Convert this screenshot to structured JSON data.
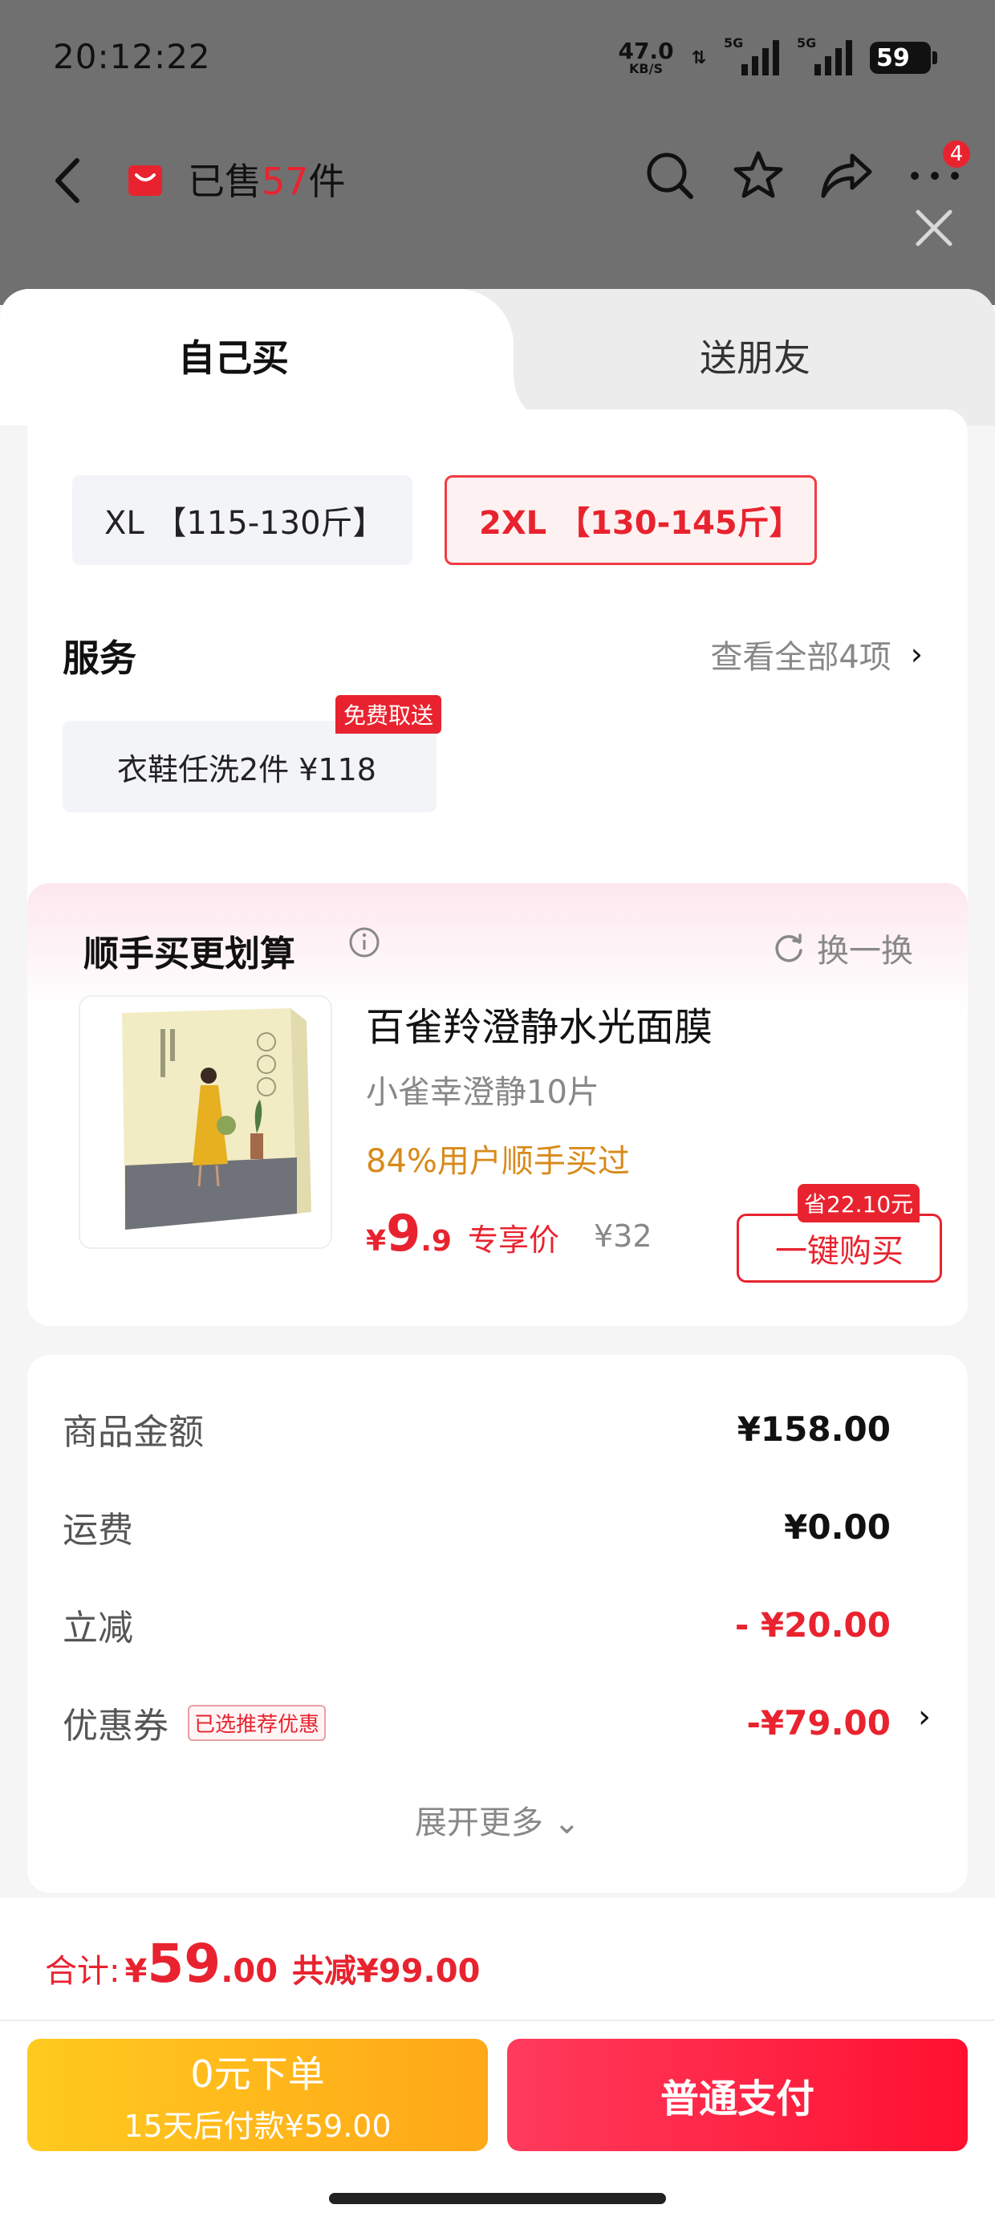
{
  "status_bar": {
    "time": "20:12:22",
    "net_speed": "47.0",
    "net_unit": "KB/S",
    "net_arrows": "⇅",
    "signal1_label": "5G",
    "signal2_label": "5G",
    "battery": "59"
  },
  "nav": {
    "sold_prefix": "已售",
    "sold_count": "57",
    "sold_suffix": "件",
    "more_badge": "4"
  },
  "tabs": {
    "self": "自己买",
    "friend": "送朋友"
  },
  "sizes": {
    "xl": "XL 【115-130斤】",
    "xxl": "2XL 【130-145斤】",
    "selected": "2XL 【130-145斤】"
  },
  "service": {
    "title": "服务",
    "view_all": "查看全部4项",
    "item": "衣鞋任洗2件 ¥118",
    "tag": "免费取送"
  },
  "addon": {
    "title": "顺手买更划算",
    "refresh": "换一换",
    "name": "百雀羚澄静水光面膜",
    "spec": "小雀幸澄静10片",
    "rate": "84%用户顺手买过",
    "price_symbol": "¥",
    "price_int": "9",
    "price_dec": ".9",
    "price_tag": "专享价",
    "orig_price": "¥32",
    "save_tag": "省22.10元",
    "buy": "一键购买"
  },
  "summary": {
    "goods_label": "商品金额",
    "goods_value": "¥158.00",
    "ship_label": "运费",
    "ship_value": "¥0.00",
    "cut_label": "立减",
    "cut_value": "- ¥20.00",
    "coupon_label": "优惠券",
    "coupon_tag": "已选推荐优惠",
    "coupon_value": "-¥79.00",
    "expand": "展开更多"
  },
  "bottom": {
    "total_label": "合计:",
    "total_symbol": "¥",
    "total_int": "59",
    "total_dec": ".00",
    "total_cut": "共减¥99.00",
    "zero_l1": "0元下单",
    "zero_l2": "15天后付款¥59.00",
    "pay": "普通支付"
  },
  "colors": {
    "accent_red": "#e8232f",
    "orange_text": "#d88a1a",
    "zero_button": "#ffb31b",
    "pay_button": "#ff1f44"
  }
}
